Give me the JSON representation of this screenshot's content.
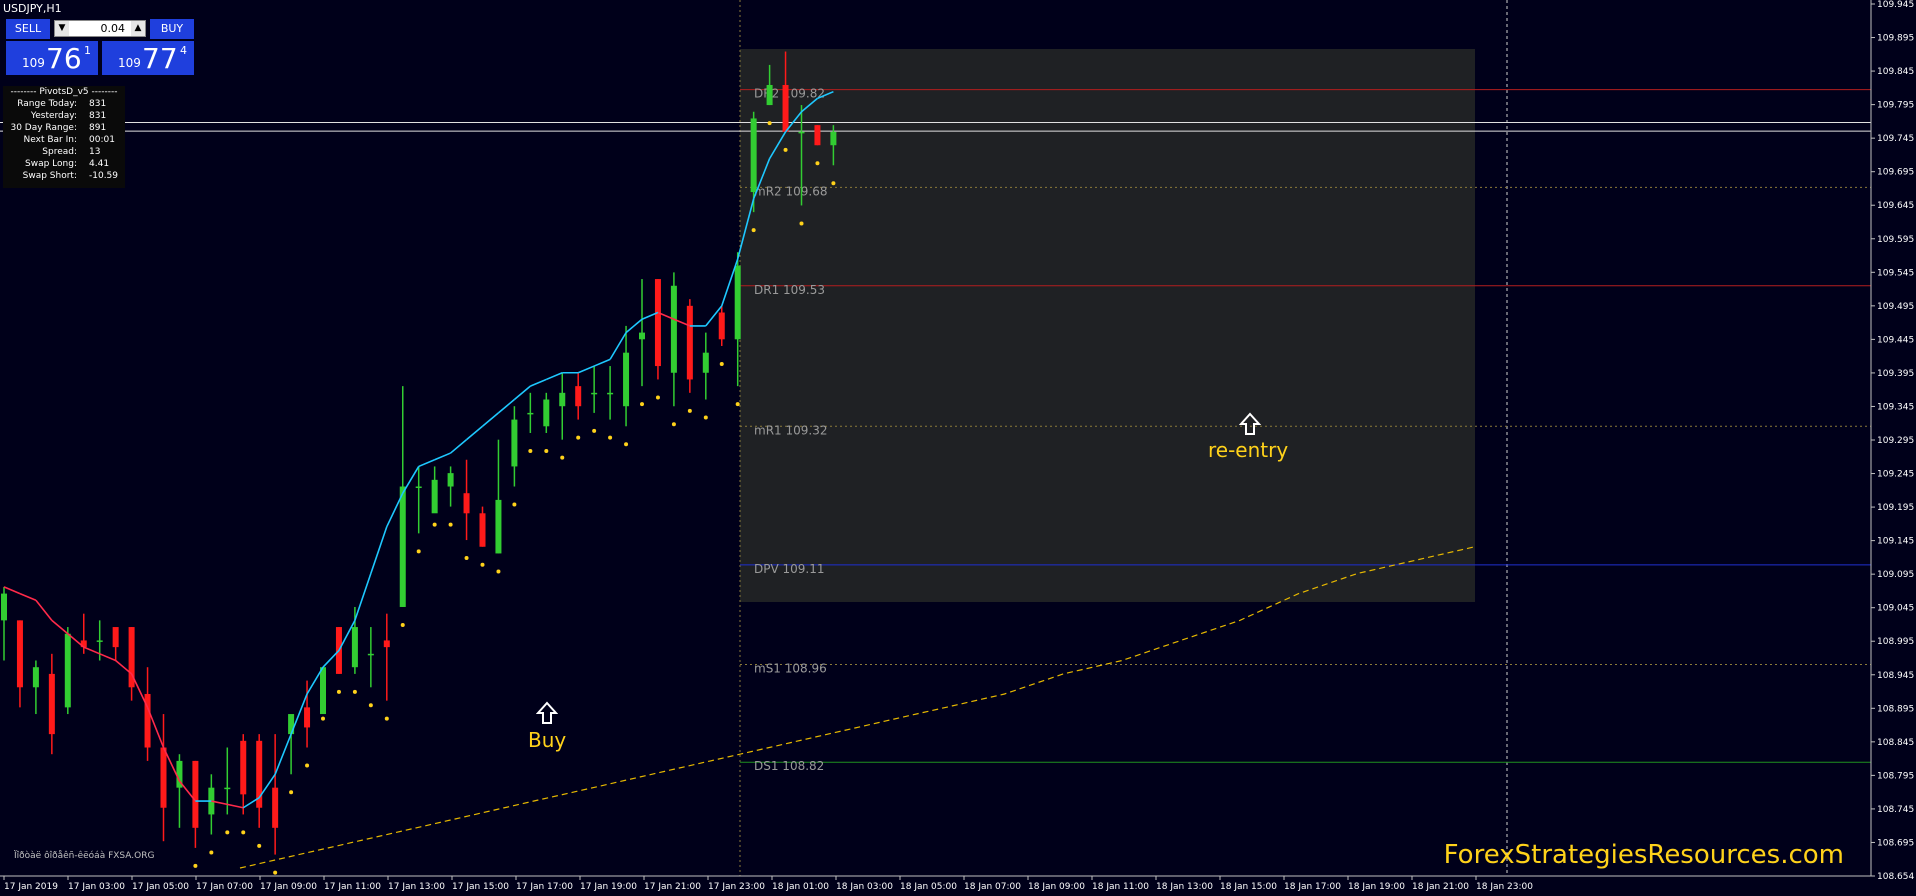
{
  "window": {
    "title": "USDJPY,H1"
  },
  "trade_panel": {
    "sell_label": "SELL",
    "buy_label": "BUY",
    "lot_value": "0.04",
    "sell_price": {
      "prefix": "109",
      "big": "76",
      "sup": "1"
    },
    "buy_price": {
      "prefix": "109",
      "big": "77",
      "sup": "4"
    }
  },
  "pivot_info": {
    "header": "-------- PivotsD_v5 --------",
    "rows": [
      {
        "k": "Range  Today:",
        "v": "831"
      },
      {
        "k": "Yesterday:",
        "v": "831"
      },
      {
        "k": "30 Day Range:",
        "v": "891"
      },
      {
        "k": "Next Bar In:",
        "v": "00:01"
      },
      {
        "k": "Spread:",
        "v": "13"
      },
      {
        "k": "Swap  Long:",
        "v": "4.41"
      },
      {
        "k": "Swap  Short:",
        "v": "-10.59"
      }
    ]
  },
  "annotations": {
    "buy": "Buy",
    "reentry": "re-entry"
  },
  "watermark": "ForexStrategiesResources.com",
  "fxsa_label": "Ïîðòàë ôîðåêñ-êëóáà FXSA.ORG",
  "pivot_levels": [
    {
      "label": "DR2",
      "value": "109.82",
      "price": 109.823,
      "color": "#b21e1e",
      "style": "solid"
    },
    {
      "label": "mR2",
      "value": "109.68",
      "price": 109.677,
      "color": "#8a7a3a",
      "style": "dotted"
    },
    {
      "label": "DR1",
      "value": "109.53",
      "price": 109.53,
      "color": "#b21e1e",
      "style": "solid"
    },
    {
      "label": "mR1",
      "value": "109.32",
      "price": 109.32,
      "color": "#8a7a3a",
      "style": "dotted"
    },
    {
      "label": "DPV",
      "value": "109.11",
      "price": 109.113,
      "color": "#1f2fcf",
      "style": "solid"
    },
    {
      "label": "mS1",
      "value": "108.96",
      "price": 108.964,
      "color": "#8a7a3a",
      "style": "dotted"
    },
    {
      "label": "DS1",
      "value": "108.82",
      "price": 108.818,
      "color": "#1f8f1f",
      "style": "solid"
    }
  ],
  "price_markers": [
    {
      "label": "109.774",
      "price": 109.774
    },
    {
      "label": "109.761",
      "price": 109.761
    }
  ],
  "chart_data": {
    "type": "candlestick",
    "symbol": "USDJPY",
    "timeframe": "H1",
    "ylim": [
      108.648,
      109.957
    ],
    "y_ticks": [
      "109.945",
      "109.895",
      "109.845",
      "109.795",
      "109.745",
      "109.695",
      "109.645",
      "109.595",
      "109.545",
      "109.495",
      "109.445",
      "109.395",
      "109.345",
      "109.295",
      "109.245",
      "109.195",
      "109.145",
      "109.095",
      "109.045",
      "108.995",
      "108.945",
      "108.895",
      "108.845",
      "108.795",
      "108.745",
      "108.695",
      "108.654"
    ],
    "x_labels": [
      "17 Jan 2019",
      "17 Jan 03:00",
      "17 Jan 05:00",
      "17 Jan 07:00",
      "17 Jan 09:00",
      "17 Jan 11:00",
      "17 Jan 13:00",
      "17 Jan 15:00",
      "17 Jan 17:00",
      "17 Jan 19:00",
      "17 Jan 21:00",
      "17 Jan 23:00",
      "18 Jan 01:00",
      "18 Jan 03:00",
      "18 Jan 05:00",
      "18 Jan 07:00",
      "18 Jan 09:00",
      "18 Jan 11:00",
      "18 Jan 13:00",
      "18 Jan 15:00",
      "18 Jan 17:00",
      "18 Jan 19:00",
      "18 Jan 21:00",
      "18 Jan 23:00"
    ],
    "candles": [
      [
        109.03,
        109.07,
        108.97,
        109.08
      ],
      [
        109.03,
        108.93,
        108.9,
        109.03
      ],
      [
        108.93,
        108.96,
        108.89,
        108.97
      ],
      [
        108.95,
        108.86,
        108.83,
        108.98
      ],
      [
        108.9,
        109.01,
        108.89,
        109.02
      ],
      [
        109.0,
        108.99,
        108.98,
        109.04
      ],
      [
        109.0,
        109.0,
        108.97,
        109.03
      ],
      [
        109.02,
        108.99,
        108.97,
        109.01
      ],
      [
        109.02,
        108.93,
        108.91,
        109.02
      ],
      [
        108.92,
        108.84,
        108.82,
        108.96
      ],
      [
        108.84,
        108.75,
        108.7,
        108.89
      ],
      [
        108.78,
        108.82,
        108.72,
        108.83
      ],
      [
        108.82,
        108.72,
        108.69,
        108.82
      ],
      [
        108.74,
        108.78,
        108.71,
        108.8
      ],
      [
        108.78,
        108.78,
        108.74,
        108.84
      ],
      [
        108.85,
        108.77,
        108.74,
        108.86
      ],
      [
        108.85,
        108.75,
        108.72,
        108.86
      ],
      [
        108.78,
        108.72,
        108.68,
        108.86
      ],
      [
        108.86,
        108.89,
        108.8,
        108.87
      ],
      [
        108.9,
        108.87,
        108.84,
        108.94
      ],
      [
        108.89,
        108.96,
        108.91,
        108.96
      ],
      [
        109.02,
        108.95,
        108.95,
        109.02
      ],
      [
        108.96,
        109.02,
        108.95,
        109.05
      ],
      [
        108.98,
        108.98,
        108.93,
        109.02
      ],
      [
        109.0,
        108.99,
        108.91,
        109.04
      ],
      [
        109.05,
        109.23,
        109.05,
        109.38
      ],
      [
        109.23,
        109.23,
        109.16,
        109.26
      ],
      [
        109.19,
        109.24,
        109.2,
        109.26
      ],
      [
        109.23,
        109.25,
        109.2,
        109.26
      ],
      [
        109.22,
        109.19,
        109.15,
        109.27
      ],
      [
        109.19,
        109.14,
        109.14,
        109.2
      ],
      [
        109.13,
        109.21,
        109.13,
        109.3
      ],
      [
        109.26,
        109.33,
        109.23,
        109.35
      ],
      [
        109.34,
        109.34,
        109.31,
        109.37
      ],
      [
        109.32,
        109.36,
        109.31,
        109.37
      ],
      [
        109.35,
        109.37,
        109.3,
        109.4
      ],
      [
        109.38,
        109.35,
        109.33,
        109.4
      ],
      [
        109.37,
        109.37,
        109.34,
        109.41
      ],
      [
        109.37,
        109.37,
        109.33,
        109.41
      ],
      [
        109.35,
        109.43,
        109.32,
        109.47
      ],
      [
        109.45,
        109.46,
        109.38,
        109.54
      ],
      [
        109.54,
        109.41,
        109.39,
        109.54
      ],
      [
        109.4,
        109.53,
        109.35,
        109.55
      ],
      [
        109.5,
        109.39,
        109.37,
        109.51
      ],
      [
        109.4,
        109.43,
        109.36,
        109.46
      ],
      [
        109.49,
        109.45,
        109.44,
        109.5
      ],
      [
        109.45,
        109.56,
        109.38,
        109.58
      ],
      [
        109.67,
        109.78,
        109.64,
        109.79
      ],
      [
        109.8,
        109.83,
        109.8,
        109.86
      ],
      [
        109.83,
        109.76,
        109.76,
        109.88
      ],
      [
        109.76,
        109.76,
        109.65,
        109.8
      ],
      [
        109.77,
        109.74,
        109.74,
        109.77
      ],
      [
        109.74,
        109.76,
        109.71,
        109.77
      ]
    ],
    "moving_average": [
      109.08,
      109.07,
      109.06,
      109.03,
      109.01,
      108.99,
      108.98,
      108.97,
      108.95,
      108.9,
      108.84,
      108.79,
      108.76,
      108.76,
      108.755,
      108.75,
      108.765,
      108.8,
      108.86,
      108.92,
      108.96,
      108.985,
      109.03,
      109.1,
      109.17,
      109.22,
      109.26,
      109.27,
      109.28,
      109.3,
      109.32,
      109.34,
      109.36,
      109.38,
      109.39,
      109.4,
      109.4,
      109.41,
      109.42,
      109.46,
      109.48,
      109.49,
      109.48,
      109.47,
      109.47,
      109.5,
      109.57,
      109.66,
      109.72,
      109.76,
      109.79,
      109.81,
      109.82
    ],
    "slow_ma": [
      108.66,
      108.68,
      108.7,
      108.72,
      108.74,
      108.76,
      108.78,
      108.8,
      108.82,
      108.84,
      108.86,
      108.88,
      108.9,
      108.92,
      108.95,
      108.97,
      109.0,
      109.03,
      109.07,
      109.1,
      109.12,
      109.14
    ],
    "notes": "Price axis on right, time axis at bottom"
  }
}
